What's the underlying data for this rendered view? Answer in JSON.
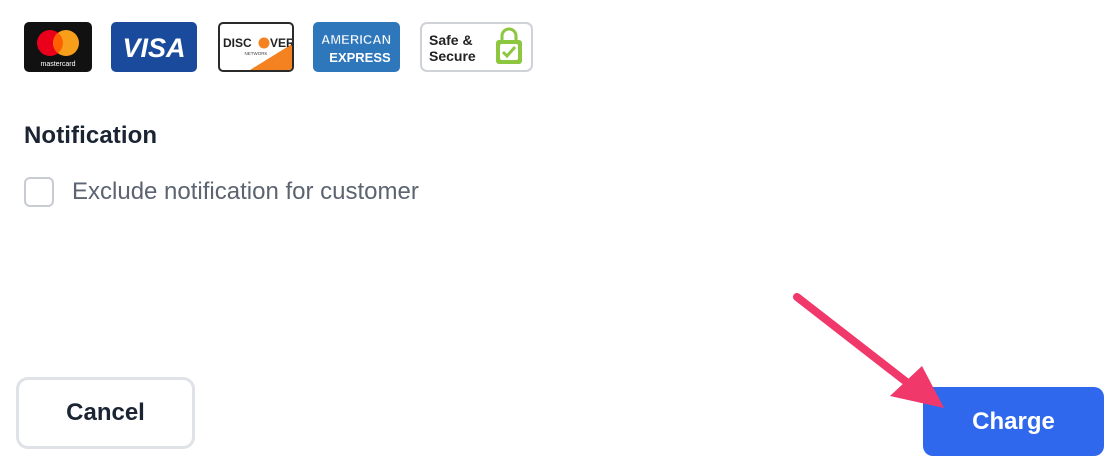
{
  "payment_logos": {
    "mastercard": {
      "wordmark": "mastercard"
    },
    "visa": {
      "wordmark": "VISA"
    },
    "discover": {
      "wordmark_a": "DISC",
      "wordmark_b": "VER",
      "sub": "NETWORK"
    },
    "amex": {
      "line1": "AMERICAN",
      "line2": "EXPRESS"
    },
    "safe_secure": {
      "line1": "Safe &",
      "line2": "Secure"
    }
  },
  "notification": {
    "title": "Notification",
    "exclude_label": "Exclude notification for customer",
    "exclude_checked": false
  },
  "actions": {
    "cancel_label": "Cancel",
    "charge_label": "Charge"
  },
  "colors": {
    "primary_button": "#2f68ec",
    "annotation_arrow": "#f0386b"
  }
}
